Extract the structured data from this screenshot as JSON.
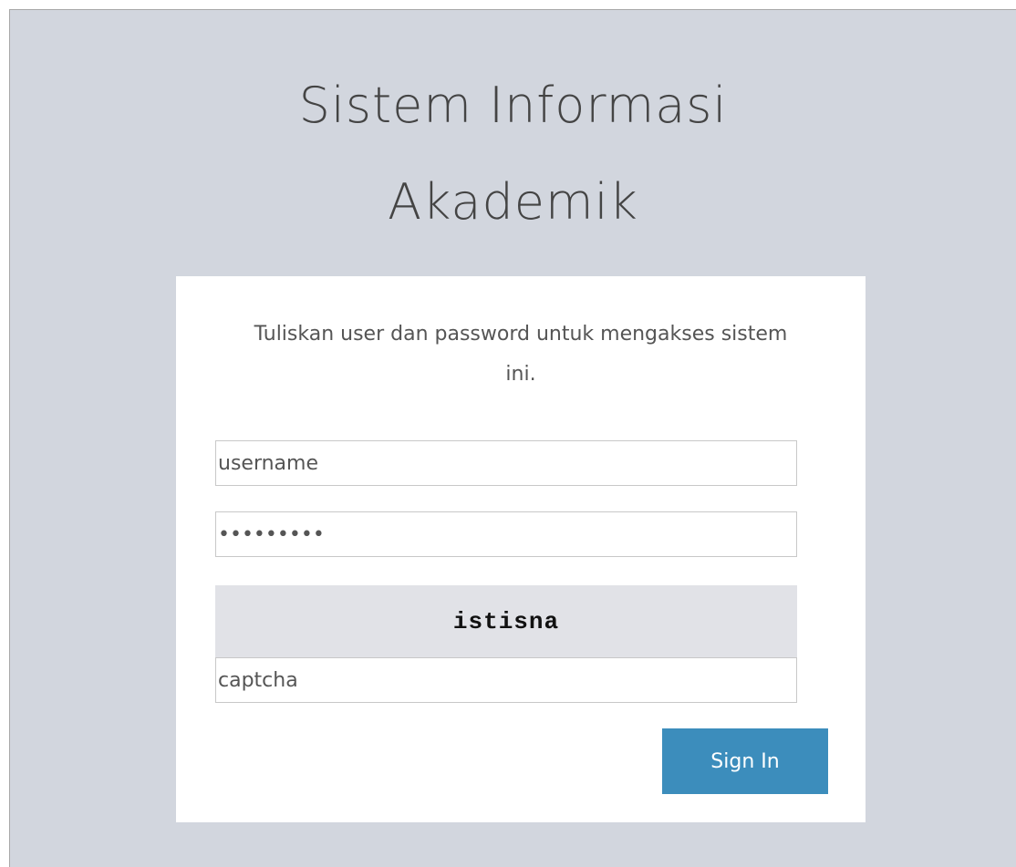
{
  "app": {
    "title_line_1": "Sistem Informasi",
    "title_line_2": "Akademik"
  },
  "login": {
    "message": "Tuliskan user dan password untuk mengakses sistem ini.",
    "username": {
      "placeholder": "username",
      "value": ""
    },
    "password": {
      "value": "•••••••••"
    },
    "captcha": {
      "image_text": "istisna",
      "placeholder": "captcha",
      "value": ""
    },
    "submit_label": "Sign In"
  },
  "colors": {
    "page_background": "#d2d6de",
    "card_background": "#ffffff",
    "primary_button": "#3c8dbc",
    "captcha_background": "#e1e2e7"
  }
}
